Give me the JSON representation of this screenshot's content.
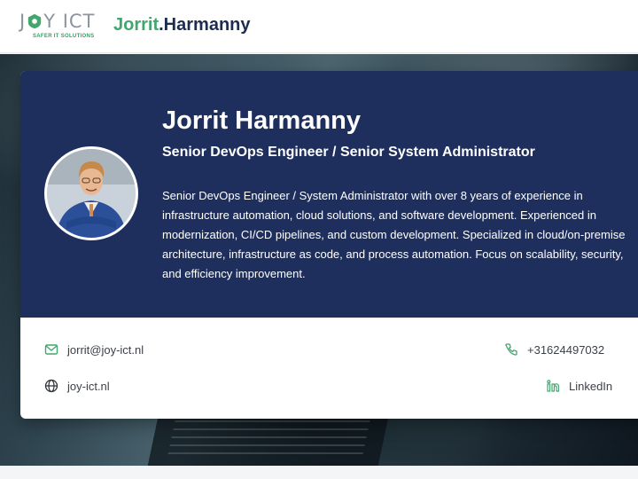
{
  "header": {
    "logo_text_left": "J",
    "logo_text_right": "Y ICT",
    "logo_tagline": "SAFER IT SOLUTIONS",
    "site_title_first": "Jorrit",
    "site_title_last": ".Harmanny"
  },
  "profile": {
    "name": "Jorrit Harmanny",
    "role": "Senior DevOps Engineer / Senior System Administrator",
    "bio": "Senior DevOps Engineer / System Administrator with over 8 years of experience in infrastructure automation, cloud solutions, and software development. Experienced in modernization, CI/CD pipelines, and custom development. Specialized in cloud/on-premise architecture, infrastructure as code, and process automation. Focus on scalability, security, and efficiency improvement."
  },
  "contacts": {
    "email": "jorrit@joy-ict.nl",
    "website": "joy-ict.nl",
    "phone": "+31624497032",
    "linkedin": "LinkedIn"
  },
  "colors": {
    "brand_green": "#43a66f",
    "brand_navy": "#1d2d4f",
    "card_navy": "#1e2f5e"
  }
}
